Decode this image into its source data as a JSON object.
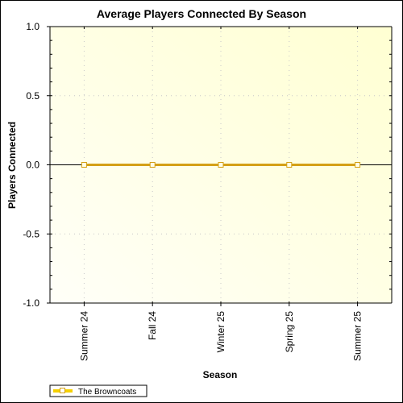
{
  "chart_data": {
    "type": "line",
    "title": "Average Players Connected By Season",
    "xlabel": "Season",
    "ylabel": "Players Connected",
    "categories": [
      "Summer 24",
      "Fall 24",
      "Winter 25",
      "Spring 25",
      "Summer 25"
    ],
    "series": [
      {
        "name": "The Browncoats",
        "values": [
          0,
          0,
          0,
          0,
          0
        ],
        "color": "#d4a017",
        "marker": "hollow-square"
      }
    ],
    "ylim": [
      -1.0,
      1.0
    ],
    "yticks": [
      1.0,
      0.5,
      0.0,
      -0.5,
      -1.0
    ],
    "ytick_labels": [
      "1.0",
      "0.5",
      "0.0",
      "-0.5",
      "-1.0"
    ],
    "y_minor_step": 0.1,
    "grid": true,
    "legend": "bottom-left",
    "plot_background": [
      "#fffff5",
      "#ffffd0"
    ]
  }
}
